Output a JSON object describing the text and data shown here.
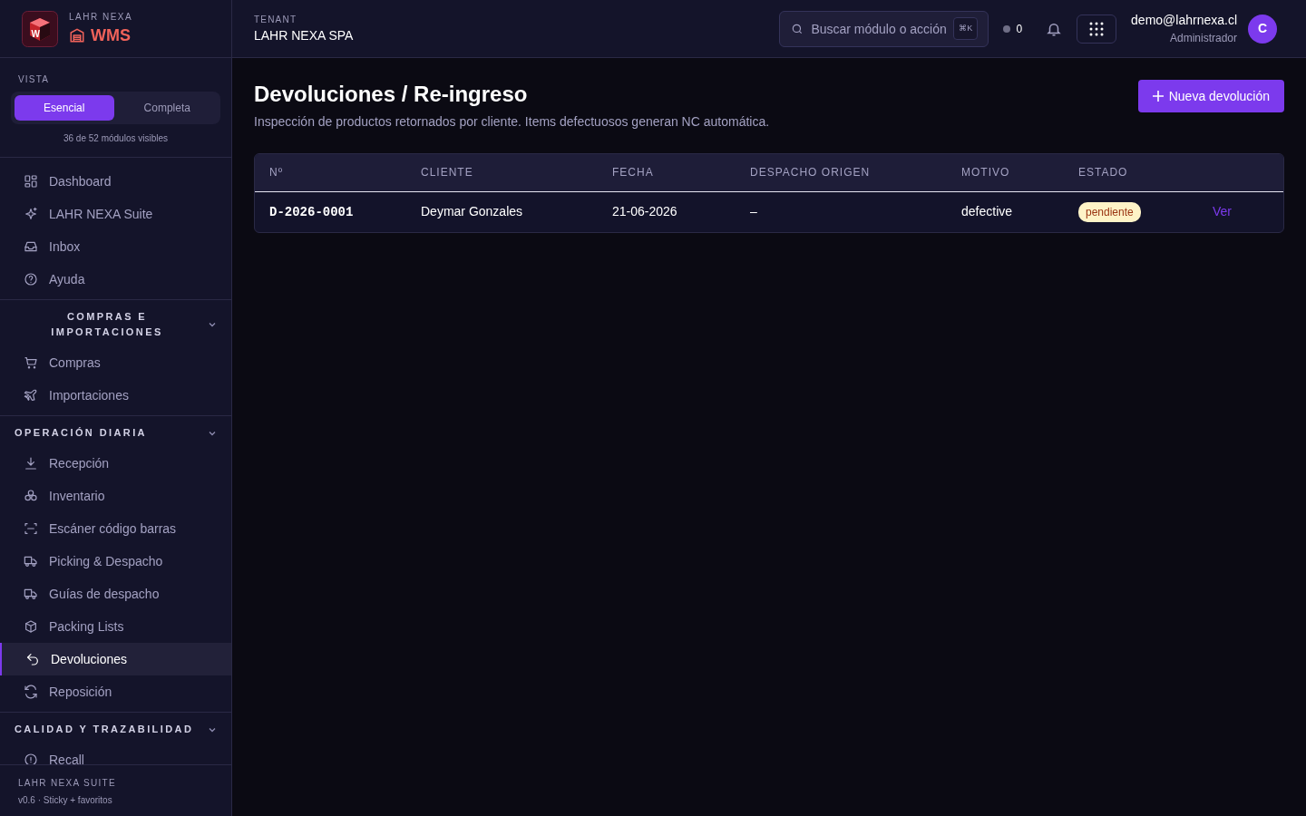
{
  "brand": {
    "overline": "LAHR NEXA",
    "title": "WMS",
    "logo_letter": "W"
  },
  "vista": {
    "label": "VISTA",
    "options": [
      {
        "label": "Esencial",
        "selected": true
      },
      {
        "label": "Completa",
        "selected": false
      }
    ],
    "note": "36 de 52 módulos visibles"
  },
  "nav": [
    {
      "items": [
        {
          "label": "Dashboard",
          "selected": false
        },
        {
          "label": "LAHR NEXA Suite",
          "selected": false
        },
        {
          "label": "Inbox",
          "selected": false
        },
        {
          "label": "Ayuda",
          "selected": false
        }
      ]
    },
    {
      "title": "COMPRAS E IMPORTACIONES",
      "expanded": true,
      "items": [
        {
          "label": "Compras",
          "selected": false
        },
        {
          "label": "Importaciones",
          "selected": false
        }
      ]
    },
    {
      "title": "OPERACIÓN DIARIA",
      "expanded": true,
      "items": [
        {
          "label": "Recepción",
          "selected": false
        },
        {
          "label": "Inventario",
          "selected": false
        },
        {
          "label": "Escáner código barras",
          "selected": false
        },
        {
          "label": "Picking & Despacho",
          "selected": false
        },
        {
          "label": "Guías de despacho",
          "selected": false
        },
        {
          "label": "Packing Lists",
          "selected": false
        },
        {
          "label": "Devoluciones",
          "selected": true
        },
        {
          "label": "Reposición",
          "selected": false
        }
      ]
    },
    {
      "title": "CALIDAD Y TRAZABILIDAD",
      "expanded": true,
      "items": [
        {
          "label": "Recall",
          "selected": false
        }
      ]
    }
  ],
  "footer": {
    "title": "LAHR NEXA SUITE",
    "subtitle": "v0.6 · Sticky + favoritos"
  },
  "topbar": {
    "tenant_label": "TENANT",
    "tenant": "LAHR NEXA SPA",
    "search": {
      "placeholder": "Buscar módulo o acción",
      "shortcut": "⌘K"
    },
    "status_count": "0",
    "user": {
      "email": "demo@lahrnexa.cl",
      "role": "Administrador",
      "initial": "C"
    }
  },
  "page": {
    "title": "Devoluciones / Re-ingreso",
    "subtitle": "Inspección de productos retornados por cliente. Items defectuosos generan NC automática.",
    "primary_button": "Nueva devolución"
  },
  "table": {
    "columns": [
      "Nº",
      "CLIENTE",
      "FECHA",
      "DESPACHO ORIGEN",
      "MOTIVO",
      "ESTADO"
    ],
    "rows": [
      {
        "number": "D-2026-0001",
        "client": "Deymar Gonzales",
        "date": "21-06-2026",
        "origin": "–",
        "reason": "defective",
        "status": {
          "label": "pendiente",
          "color": "#fef3c7"
        },
        "action": "Ver"
      }
    ]
  }
}
